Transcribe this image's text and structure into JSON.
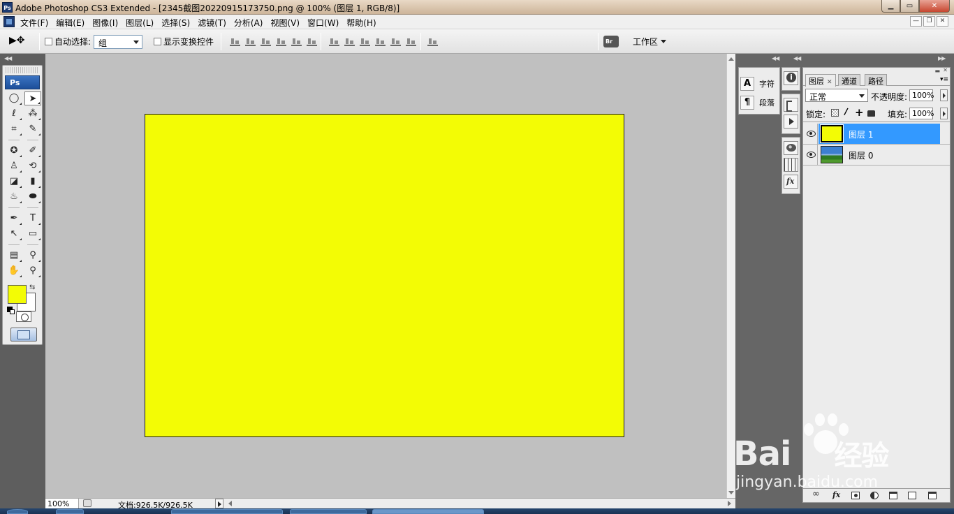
{
  "window": {
    "title": "Adobe Photoshop CS3 Extended - [2345截图20220915173750.png @ 100% (图层 1, RGB/8)]",
    "app_badge": "Ps",
    "controls": {
      "minimize": "▁",
      "maximize": "▭",
      "close": "✕"
    }
  },
  "menubar": {
    "items": [
      "文件(F)",
      "编辑(E)",
      "图像(I)",
      "图层(L)",
      "选择(S)",
      "滤镜(T)",
      "分析(A)",
      "视图(V)",
      "窗口(W)",
      "帮助(H)"
    ],
    "doc_controls": {
      "minimize": "—",
      "restore": "❐",
      "close": "✕"
    }
  },
  "options_bar": {
    "tool_icon": "move-tool-icon",
    "tool_glyph": "▶✥",
    "auto_select_label": "自动选择:",
    "auto_select_value": "组",
    "show_transform_label": "显示变换控件",
    "workspace_label": "工作区"
  },
  "toolbox": {
    "logo": "Ps",
    "foreground_color": "#f3fc05",
    "background_color": "#ffffff",
    "tools": [
      {
        "name": "marquee-tool-icon",
        "glyph": "◯"
      },
      {
        "name": "move-tool-icon",
        "glyph": "➤",
        "active": true
      },
      {
        "name": "lasso-tool-icon",
        "glyph": "ℓ"
      },
      {
        "name": "magic-wand-tool-icon",
        "glyph": "⁂"
      },
      {
        "name": "crop-tool-icon",
        "glyph": "⌗"
      },
      {
        "name": "slice-tool-icon",
        "glyph": "✎"
      },
      {
        "name": "healing-brush-tool-icon",
        "glyph": "✪"
      },
      {
        "name": "brush-tool-icon",
        "glyph": "✐"
      },
      {
        "name": "clone-stamp-tool-icon",
        "glyph": "♙"
      },
      {
        "name": "history-brush-tool-icon",
        "glyph": "⟲"
      },
      {
        "name": "eraser-tool-icon",
        "glyph": "◪"
      },
      {
        "name": "gradient-tool-icon",
        "glyph": "▮"
      },
      {
        "name": "blur-tool-icon",
        "glyph": "♨"
      },
      {
        "name": "dodge-tool-icon",
        "glyph": "⬬"
      },
      {
        "name": "pen-tool-icon",
        "glyph": "✒"
      },
      {
        "name": "type-tool-icon",
        "glyph": "T"
      },
      {
        "name": "path-selection-tool-icon",
        "glyph": "↖"
      },
      {
        "name": "shape-tool-icon",
        "glyph": "▭"
      },
      {
        "name": "notes-tool-icon",
        "glyph": "▤"
      },
      {
        "name": "eyedropper-tool-icon",
        "glyph": "⚲"
      },
      {
        "name": "hand-tool-icon",
        "glyph": "✋"
      },
      {
        "name": "zoom-tool-icon",
        "glyph": "⚲"
      }
    ]
  },
  "canvas": {
    "fill_color": "#f3fc05"
  },
  "statusbar": {
    "zoom": "100%",
    "doc_info": "文档:926.5K/926.5K"
  },
  "mini_panel": {
    "character_label": "字符",
    "character_glyph": "A",
    "paragraph_label": "段落",
    "paragraph_glyph": "¶"
  },
  "layers_panel": {
    "tabs": [
      "图层",
      "通道",
      "路径"
    ],
    "blend_mode": "正常",
    "opacity_label": "不透明度:",
    "opacity_value": "100%",
    "lock_label": "锁定:",
    "fill_label": "填充:",
    "fill_value": "100%",
    "layers": [
      {
        "name": "图层 1",
        "selected": true,
        "thumb_color": "#f3fc05"
      },
      {
        "name": "图层 0",
        "selected": false,
        "thumb_color": "photo"
      }
    ]
  },
  "watermark": {
    "brand": "Bai",
    "brand_suffix": "经验",
    "url": "jingyan.baidu.com"
  }
}
